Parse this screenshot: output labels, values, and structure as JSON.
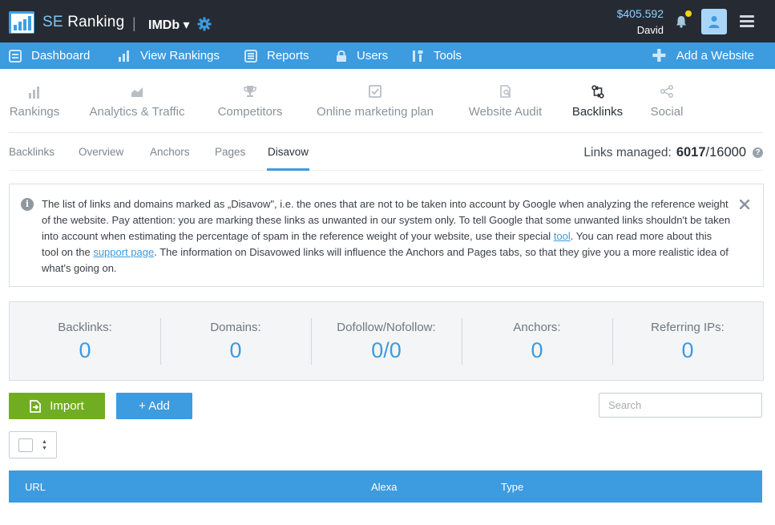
{
  "app": {
    "brand_se": "SE",
    "brand_rest": "Ranking",
    "separator": "|",
    "project": "IMDb ▾",
    "balance": "$405.592",
    "user": "David"
  },
  "main_nav": {
    "items": [
      {
        "label": "Dashboard",
        "icon": "dashboard-icon"
      },
      {
        "label": "View Rankings",
        "icon": "bar-chart-icon"
      },
      {
        "label": "Reports",
        "icon": "reports-icon"
      },
      {
        "label": "Users",
        "icon": "lock-icon"
      },
      {
        "label": "Tools",
        "icon": "tools-icon"
      }
    ],
    "add_website": "Add a Website"
  },
  "module_tabs": [
    {
      "label": "Rankings",
      "icon": "bar-chart-icon",
      "active": false
    },
    {
      "label": "Analytics & Traffic",
      "icon": "area-chart-icon",
      "active": false
    },
    {
      "label": "Competitors",
      "icon": "trophy-icon",
      "active": false
    },
    {
      "label": "Online marketing plan",
      "icon": "checkbox-icon",
      "active": false
    },
    {
      "label": "Website Audit",
      "icon": "audit-icon",
      "active": false
    },
    {
      "label": "Backlinks",
      "icon": "backlinks-icon",
      "active": true
    },
    {
      "label": "Social",
      "icon": "share-icon",
      "active": false
    }
  ],
  "sub_tabs": [
    {
      "label": "Backlinks",
      "active": false
    },
    {
      "label": "Overview",
      "active": false
    },
    {
      "label": "Anchors",
      "active": false
    },
    {
      "label": "Pages",
      "active": false
    },
    {
      "label": "Disavow",
      "active": true
    }
  ],
  "links_managed": {
    "label": "Links managed:",
    "used": "6017",
    "total": "/16000"
  },
  "info": {
    "text_1": "The list of links and domains marked as „Disavow\", i.e. the ones that are not to be taken into account by Google when analyzing the reference weight of the website. Pay attention: you are marking these links as unwanted in our system only. To tell Google that some unwanted links shouldn't be taken into account when estimating the percentage of spam in the reference weight of your website, use their special ",
    "link_tool": "tool",
    "text_2": ". You can read more about this tool on the ",
    "link_support": "support page",
    "text_3": ". The information on Disavowed links will influence the Anchors and Pages tabs, so that they give you a more realistic idea of what's going on."
  },
  "stats": [
    {
      "label": "Backlinks:",
      "value": "0"
    },
    {
      "label": "Domains:",
      "value": "0"
    },
    {
      "label": "Dofollow/Nofollow:",
      "value": "0/0"
    },
    {
      "label": "Anchors:",
      "value": "0"
    },
    {
      "label": "Referring IPs:",
      "value": "0"
    }
  ],
  "actions": {
    "import_label": "Import",
    "add_label": "+ Add",
    "search_placeholder": "Search"
  },
  "table": {
    "columns": [
      "URL",
      "Alexa",
      "Type"
    ]
  },
  "colors": {
    "topbar": "#262b33",
    "accent_blue": "#3d9bdf",
    "import_green": "#71ad22",
    "notification_dot": "#f5d20c"
  }
}
